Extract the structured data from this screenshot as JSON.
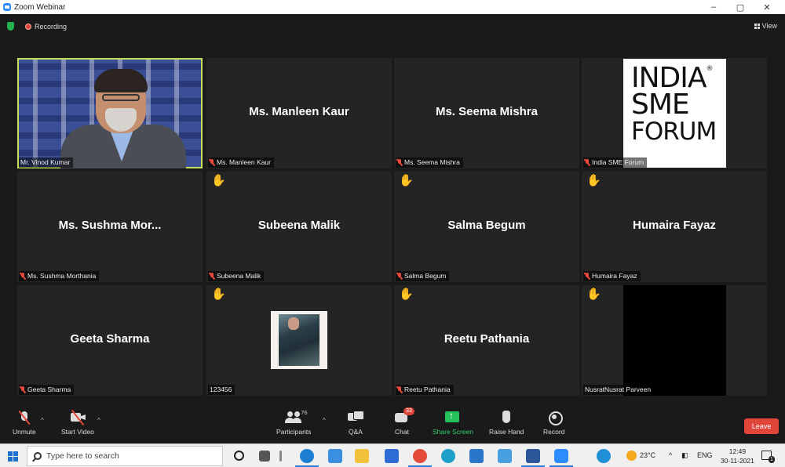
{
  "window": {
    "title": "Zoom Webinar",
    "minimize": "–",
    "restore": "▢",
    "close": "✕"
  },
  "topbar": {
    "recording": "Recording",
    "view": "View"
  },
  "tiles": [
    {
      "name": "Mr. Vinod Kumar",
      "label": "Mr. Vinod Kumar",
      "muted": false,
      "hand": false
    },
    {
      "name": "Ms. Manleen Kaur",
      "label": "Ms. Manleen Kaur",
      "muted": true,
      "hand": false
    },
    {
      "name": "Ms. Seema Mishra",
      "label": "Ms. Seema Mishra",
      "muted": true,
      "hand": false
    },
    {
      "name": "India SME Forum",
      "label": "India SME Forum",
      "muted": true,
      "hand": false
    },
    {
      "name": "Ms.  Sushma  Mor...",
      "label": "Ms. Sushma Morthania",
      "muted": true,
      "hand": false
    },
    {
      "name": "Subeena Malik",
      "label": "Subeena Malik",
      "muted": true,
      "hand": true
    },
    {
      "name": "Salma Begum",
      "label": "Salma Begum",
      "muted": true,
      "hand": true
    },
    {
      "name": "Humaira Fayaz",
      "label": "Humaira Fayaz",
      "muted": true,
      "hand": true
    },
    {
      "name": "Geeta Sharma",
      "label": "Geeta Sharma",
      "muted": true,
      "hand": false
    },
    {
      "name": "123456",
      "label": "123456",
      "muted": false,
      "hand": true
    },
    {
      "name": "Reetu Pathania",
      "label": "Reetu Pathania",
      "muted": true,
      "hand": true
    },
    {
      "name": "NusratNusrat Parveen",
      "label": "NusratNusrat Parveen",
      "muted": false,
      "hand": true
    }
  ],
  "logo": {
    "line1": "INDIA",
    "mark": "®",
    "line2": "SME",
    "line3": "FORUM"
  },
  "hand_glyph": "✋",
  "toolbar": {
    "unmute": "Unmute",
    "start_video": "Start Video",
    "participants": "Participants",
    "participants_count": "76",
    "qa": "Q&A",
    "chat": "Chat",
    "chat_badge": "33",
    "share_screen": "Share Screen",
    "raise_hand": "Raise Hand",
    "record": "Record",
    "leave": "Leave",
    "caret": "^"
  },
  "taskbar": {
    "search_placeholder": "Type here to search",
    "weather": "23°C",
    "lang": "ENG",
    "time": "12:49",
    "date": "30-11-2021",
    "notifications": "1"
  },
  "colors": {
    "active_speaker_border": "#c3e25a",
    "leave": "#e0453a",
    "share": "#23c25d",
    "hand": "#f2b61b"
  }
}
